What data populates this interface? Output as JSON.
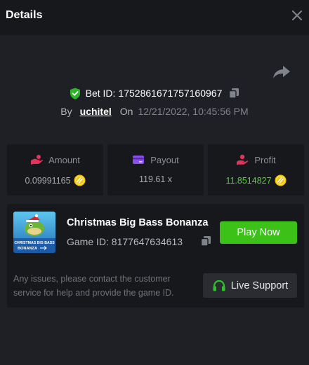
{
  "header": {
    "title": "Details"
  },
  "bet": {
    "id_label": "Bet ID:",
    "id_value": "1752861671757160967",
    "by_label": "By",
    "user": "uchitel",
    "on_label": "On",
    "date": "12/21/2022, 10:45:56 PM"
  },
  "stats": [
    {
      "label": "Amount",
      "value": "0.09991165",
      "icon": "hand-coins-icon",
      "coin": true
    },
    {
      "label": "Payout",
      "value": "119.61 x",
      "icon": "card-icon",
      "coin": false
    },
    {
      "label": "Profit",
      "value": "11.8514827",
      "icon": "profit-hand-icon",
      "coin": true
    }
  ],
  "game": {
    "name": "Christmas Big Bass Bonanza",
    "id_label": "Game ID:",
    "id_value": "8177647634613",
    "thumb_text_1": "CHRISTMAS BIG BASS",
    "thumb_text_2": "BONANZA",
    "play_label": "Play Now"
  },
  "support": {
    "issue_text": "Any issues, please contact the customer service for help and provide the game ID.",
    "button_label": "Live Support"
  },
  "colors": {
    "background": "#1f2025",
    "panel": "#17181b",
    "accent_green": "#3bc117",
    "profit_green": "#4fd53a",
    "amount_icon": "#e0365e",
    "payout_icon": "#8b4ff0",
    "profit_icon": "#e0365e",
    "coin": "#f5c400",
    "shield": "#2fb52a"
  }
}
